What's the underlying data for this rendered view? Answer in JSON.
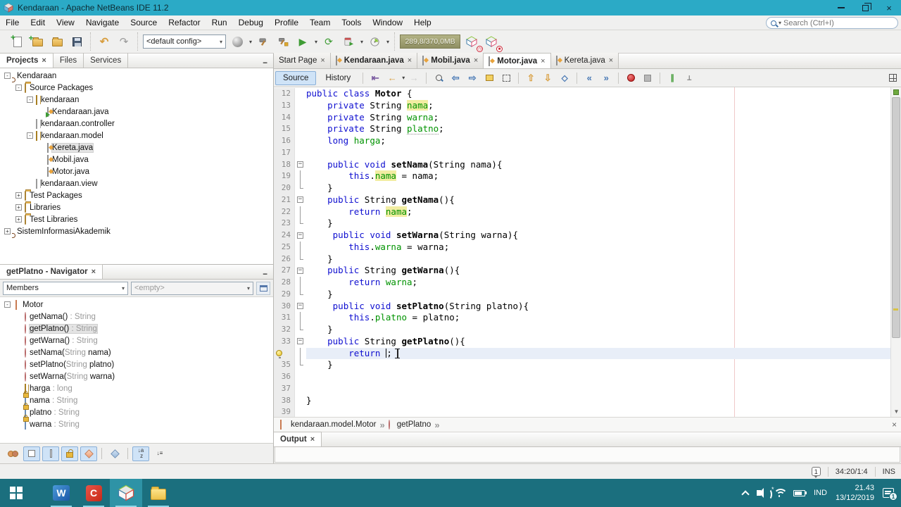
{
  "titlebar": {
    "title": "Kendaraan - Apache NetBeans IDE 11.2"
  },
  "menubar": [
    "File",
    "Edit",
    "View",
    "Navigate",
    "Source",
    "Refactor",
    "Run",
    "Debug",
    "Profile",
    "Team",
    "Tools",
    "Window",
    "Help"
  ],
  "toolbar": {
    "config": "<default config>",
    "memory": "289,8/370,0MB"
  },
  "search": {
    "placeholder": "Search (Ctrl+I)"
  },
  "projects": {
    "tabs": [
      "Projects",
      "Files",
      "Services"
    ],
    "active_tab": "Projects",
    "tree": [
      {
        "depth": 0,
        "exp": "-",
        "icon": "java-project",
        "label": "Kendaraan"
      },
      {
        "depth": 1,
        "exp": "-",
        "icon": "folder",
        "label": "Source Packages"
      },
      {
        "depth": 2,
        "exp": "-",
        "icon": "package",
        "label": "kendaraan"
      },
      {
        "depth": 3,
        "exp": "",
        "icon": "java-main",
        "label": "Kendaraan.java"
      },
      {
        "depth": 2,
        "exp": "",
        "icon": "package-empty",
        "label": "kendaraan.controller"
      },
      {
        "depth": 2,
        "exp": "-",
        "icon": "package",
        "label": "kendaraan.model"
      },
      {
        "depth": 3,
        "exp": "",
        "icon": "java-file",
        "label": "Kereta.java",
        "selected": true
      },
      {
        "depth": 3,
        "exp": "",
        "icon": "java-file",
        "label": "Mobil.java"
      },
      {
        "depth": 3,
        "exp": "",
        "icon": "java-file",
        "label": "Motor.java"
      },
      {
        "depth": 2,
        "exp": "",
        "icon": "package-empty",
        "label": "kendaraan.view"
      },
      {
        "depth": 1,
        "exp": "+",
        "icon": "folder",
        "label": "Test Packages"
      },
      {
        "depth": 1,
        "exp": "+",
        "icon": "folder",
        "label": "Libraries"
      },
      {
        "depth": 1,
        "exp": "+",
        "icon": "folder",
        "label": "Test Libraries"
      },
      {
        "depth": 0,
        "exp": "+",
        "icon": "java-project",
        "label": "SistemInformasiAkademik"
      }
    ]
  },
  "navigator": {
    "title": "getPlatno - Navigator",
    "members_filter": "Members",
    "inspect_value": "<empty>",
    "items": [
      {
        "depth": 0,
        "exp": "-",
        "icon": "class",
        "pre": "Motor",
        "dim": "",
        "post": ""
      },
      {
        "depth": 1,
        "exp": "",
        "icon": "method",
        "pre": "getNama()",
        "dim": " : String",
        "post": ""
      },
      {
        "depth": 1,
        "exp": "",
        "icon": "method",
        "pre": "getPlatno()",
        "dim": " : String",
        "post": "",
        "selected": true
      },
      {
        "depth": 1,
        "exp": "",
        "icon": "method",
        "pre": "getWarna()",
        "dim": " : String",
        "post": ""
      },
      {
        "depth": 1,
        "exp": "",
        "icon": "method",
        "pre": "setNama(",
        "dim": "String ",
        "post": "nama)"
      },
      {
        "depth": 1,
        "exp": "",
        "icon": "method",
        "pre": "setPlatno(",
        "dim": "String ",
        "post": "platno)"
      },
      {
        "depth": 1,
        "exp": "",
        "icon": "method",
        "pre": "setWarna(",
        "dim": "String ",
        "post": "warna)"
      },
      {
        "depth": 1,
        "exp": "",
        "icon": "field",
        "pre": "harga",
        "dim": " : long",
        "post": ""
      },
      {
        "depth": 1,
        "exp": "",
        "icon": "field-private",
        "pre": "nama",
        "dim": " : String",
        "post": ""
      },
      {
        "depth": 1,
        "exp": "",
        "icon": "field-private",
        "pre": "platno",
        "dim": " : String",
        "post": ""
      },
      {
        "depth": 1,
        "exp": "",
        "icon": "field-private",
        "pre": "warna",
        "dim": " : String",
        "post": ""
      }
    ]
  },
  "editor": {
    "tabs": [
      {
        "label": "Start Page",
        "icon": false,
        "bold": false,
        "active": false
      },
      {
        "label": "Kendaraan.java",
        "icon": true,
        "bold": true,
        "active": false
      },
      {
        "label": "Mobil.java",
        "icon": true,
        "bold": true,
        "active": false
      },
      {
        "label": "Motor.java",
        "icon": true,
        "bold": true,
        "active": true
      },
      {
        "label": "Kereta.java",
        "icon": true,
        "bold": false,
        "active": false
      }
    ],
    "views": [
      "Source",
      "History"
    ],
    "breadcrumb": [
      {
        "icon": "class-icon",
        "label": "kendaraan.model.Motor"
      },
      {
        "icon": "method-icon",
        "label": "getPlatno"
      }
    ],
    "code": [
      {
        "n": "12",
        "f": "",
        "t": [
          [
            "kw",
            "public"
          ],
          [
            "pl",
            " "
          ],
          [
            "kw",
            "class"
          ],
          [
            "pl",
            " "
          ],
          [
            "b",
            "Motor"
          ],
          [
            "pl",
            " {"
          ]
        ]
      },
      {
        "n": "13",
        "f": "",
        "t": [
          [
            "pl",
            "    "
          ],
          [
            "kw",
            "private"
          ],
          [
            "pl",
            " String "
          ],
          [
            "occ",
            "nama"
          ],
          [
            "pl",
            ";"
          ]
        ]
      },
      {
        "n": "14",
        "f": "",
        "t": [
          [
            "pl",
            "    "
          ],
          [
            "kw",
            "private"
          ],
          [
            "pl",
            " String "
          ],
          [
            "fld",
            "warna"
          ],
          [
            "pl",
            ";"
          ]
        ]
      },
      {
        "n": "15",
        "f": "",
        "t": [
          [
            "pl",
            "    "
          ],
          [
            "kw",
            "private"
          ],
          [
            "pl",
            " String "
          ],
          [
            "flderr",
            "platno"
          ],
          [
            "pl",
            ";"
          ]
        ]
      },
      {
        "n": "16",
        "f": "",
        "t": [
          [
            "pl",
            "    "
          ],
          [
            "kw",
            "long"
          ],
          [
            "pl",
            " "
          ],
          [
            "fld",
            "harga"
          ],
          [
            "pl",
            ";"
          ]
        ]
      },
      {
        "n": "17",
        "f": "",
        "t": []
      },
      {
        "n": "18",
        "f": "start",
        "t": [
          [
            "pl",
            "    "
          ],
          [
            "kw",
            "public"
          ],
          [
            "pl",
            " "
          ],
          [
            "kw",
            "void"
          ],
          [
            "pl",
            " "
          ],
          [
            "b",
            "setNama"
          ],
          [
            "pl",
            "(String nama){"
          ]
        ]
      },
      {
        "n": "19",
        "f": "mid",
        "t": [
          [
            "pl",
            "        "
          ],
          [
            "kw",
            "this"
          ],
          [
            "pl",
            "."
          ],
          [
            "occ",
            "nama"
          ],
          [
            "pl",
            " = nama;"
          ]
        ]
      },
      {
        "n": "20",
        "f": "end",
        "t": [
          [
            "pl",
            "    }"
          ]
        ]
      },
      {
        "n": "21",
        "f": "start",
        "t": [
          [
            "pl",
            "    "
          ],
          [
            "kw",
            "public"
          ],
          [
            "pl",
            " String "
          ],
          [
            "b",
            "getNama"
          ],
          [
            "pl",
            "(){"
          ]
        ]
      },
      {
        "n": "22",
        "f": "mid",
        "t": [
          [
            "pl",
            "        "
          ],
          [
            "kw",
            "return"
          ],
          [
            "pl",
            " "
          ],
          [
            "occ",
            "nama"
          ],
          [
            "pl",
            ";"
          ]
        ]
      },
      {
        "n": "23",
        "f": "end",
        "t": [
          [
            "pl",
            "    }"
          ]
        ]
      },
      {
        "n": "24",
        "f": "start",
        "t": [
          [
            "pl",
            "     "
          ],
          [
            "kw",
            "public"
          ],
          [
            "pl",
            " "
          ],
          [
            "kw",
            "void"
          ],
          [
            "pl",
            " "
          ],
          [
            "b",
            "setWarna"
          ],
          [
            "pl",
            "(String warna){"
          ]
        ]
      },
      {
        "n": "25",
        "f": "mid",
        "t": [
          [
            "pl",
            "        "
          ],
          [
            "kw",
            "this"
          ],
          [
            "pl",
            "."
          ],
          [
            "fld",
            "warna"
          ],
          [
            "pl",
            " = warna;"
          ]
        ]
      },
      {
        "n": "26",
        "f": "end",
        "t": [
          [
            "pl",
            "    }"
          ]
        ]
      },
      {
        "n": "27",
        "f": "start",
        "t": [
          [
            "pl",
            "    "
          ],
          [
            "kw",
            "public"
          ],
          [
            "pl",
            " String "
          ],
          [
            "b",
            "getWarna"
          ],
          [
            "pl",
            "(){"
          ]
        ]
      },
      {
        "n": "28",
        "f": "mid",
        "t": [
          [
            "pl",
            "        "
          ],
          [
            "kw",
            "return"
          ],
          [
            "pl",
            " "
          ],
          [
            "fld",
            "warna"
          ],
          [
            "pl",
            ";"
          ]
        ]
      },
      {
        "n": "29",
        "f": "end",
        "t": [
          [
            "pl",
            "    }"
          ]
        ]
      },
      {
        "n": "30",
        "f": "start",
        "t": [
          [
            "pl",
            "     "
          ],
          [
            "kw",
            "public"
          ],
          [
            "pl",
            " "
          ],
          [
            "kw",
            "void"
          ],
          [
            "pl",
            " "
          ],
          [
            "b",
            "setPlatno"
          ],
          [
            "pl",
            "(String platno){"
          ]
        ]
      },
      {
        "n": "31",
        "f": "mid",
        "t": [
          [
            "pl",
            "        "
          ],
          [
            "kw",
            "this"
          ],
          [
            "pl",
            "."
          ],
          [
            "fld",
            "platno"
          ],
          [
            "pl",
            " = platno;"
          ]
        ]
      },
      {
        "n": "32",
        "f": "end",
        "t": [
          [
            "pl",
            "    }"
          ]
        ]
      },
      {
        "n": "33",
        "f": "start",
        "t": [
          [
            "pl",
            "    "
          ],
          [
            "kw",
            "public"
          ],
          [
            "pl",
            " String "
          ],
          [
            "b",
            "getPlatno"
          ],
          [
            "pl",
            "(){"
          ]
        ]
      },
      {
        "n": "34",
        "f": "mid",
        "bulb": true,
        "cur": true,
        "t": [
          [
            "pl",
            "        "
          ],
          [
            "kw",
            "return"
          ],
          [
            "pl",
            " "
          ],
          [
            "caret",
            ""
          ],
          [
            "pl",
            ";"
          ]
        ]
      },
      {
        "n": "35",
        "f": "end",
        "t": [
          [
            "pl",
            "    }"
          ]
        ]
      },
      {
        "n": "36",
        "f": "",
        "t": []
      },
      {
        "n": "37",
        "f": "",
        "t": []
      },
      {
        "n": "38",
        "f": "",
        "t": [
          [
            "pl",
            "}"
          ]
        ]
      },
      {
        "n": "39",
        "f": "",
        "t": []
      }
    ]
  },
  "output": {
    "title": "Output"
  },
  "statusbar": {
    "notification_count": "1",
    "caret_position": "34:20/1:4",
    "insert_mode": "INS"
  },
  "taskbar": {
    "language": "IND",
    "time": "21.43",
    "date": "13/12/2019",
    "notification_count": "1"
  }
}
